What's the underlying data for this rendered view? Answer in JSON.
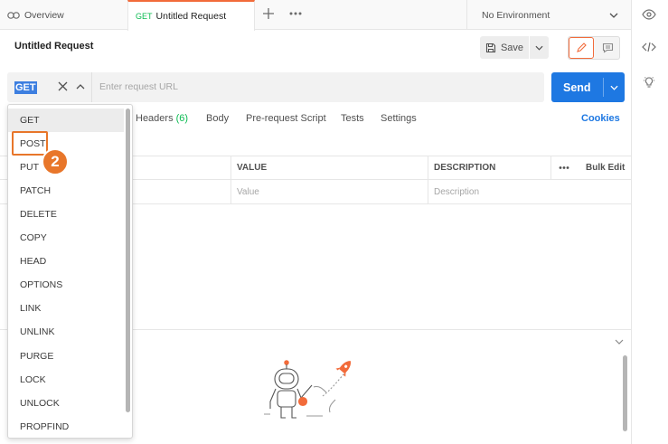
{
  "tabs": {
    "overview_label": "Overview",
    "active_method": "GET",
    "active_title": "Untitled Request"
  },
  "environment": {
    "label": "No Environment"
  },
  "request": {
    "title": "Untitled Request",
    "save_label": "Save",
    "method": "GET",
    "url_placeholder": "Enter request URL",
    "send_label": "Send"
  },
  "subtabs": {
    "headers_label": "Headers",
    "headers_count": "(6)",
    "body_label": "Body",
    "prerequest_label": "Pre-request Script",
    "tests_label": "Tests",
    "settings_label": "Settings",
    "cookies_label": "Cookies"
  },
  "params_table": {
    "value_header": "VALUE",
    "description_header": "DESCRIPTION",
    "bulk_edit_label": "Bulk Edit",
    "value_placeholder": "Value",
    "description_placeholder": "Description"
  },
  "method_menu": {
    "items": [
      "GET",
      "POST",
      "PUT",
      "PATCH",
      "DELETE",
      "COPY",
      "HEAD",
      "OPTIONS",
      "LINK",
      "UNLINK",
      "PURGE",
      "LOCK",
      "UNLOCK",
      "PROPFIND"
    ],
    "hovered_index": 0,
    "highlighted_index": 1
  },
  "annotation": {
    "step_number": "2"
  },
  "colors": {
    "accent_orange": "#e8762a",
    "send_blue": "#1e78e2",
    "get_green": "#0cbb52",
    "headers_count_green": "#0cbb52",
    "cookies_blue": "#1e78e2"
  }
}
